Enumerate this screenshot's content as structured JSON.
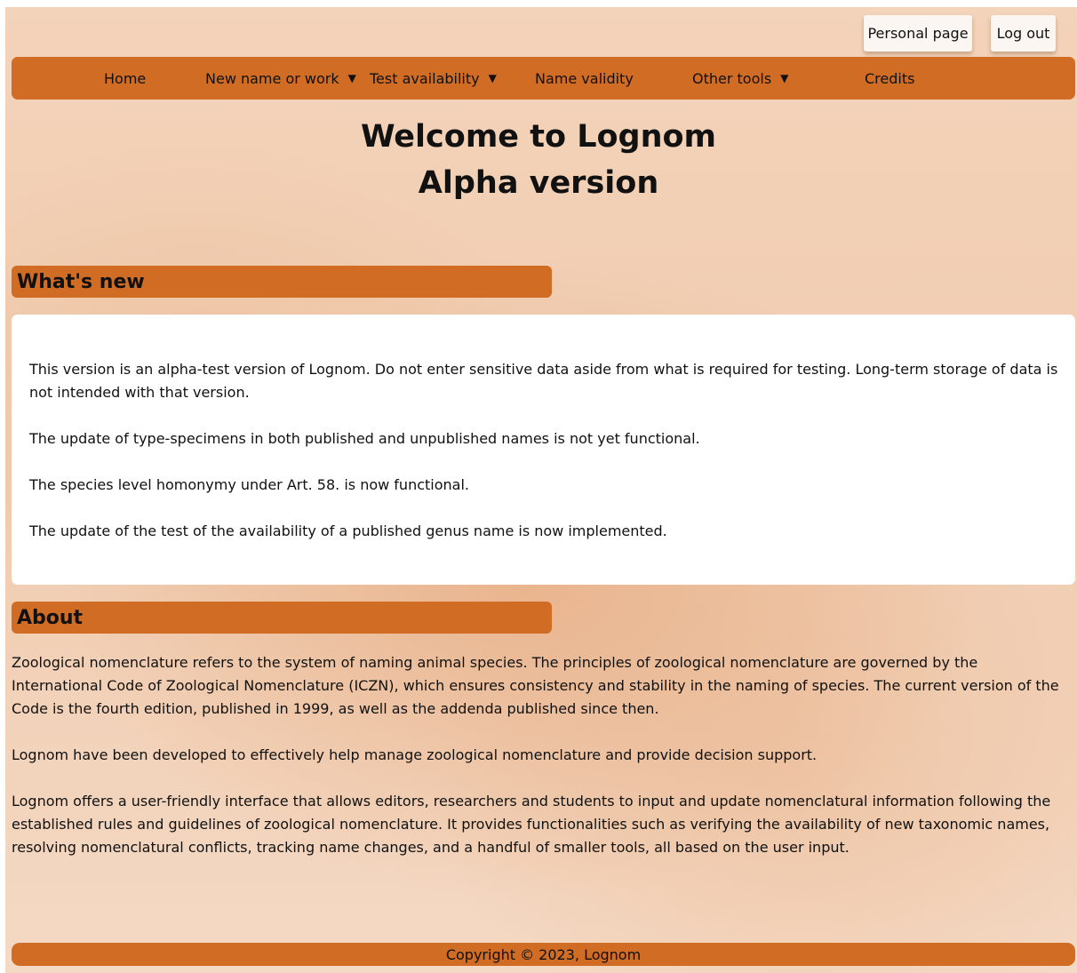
{
  "top_buttons": {
    "personal_page": "Personal page",
    "log_out": "Log out"
  },
  "nav": {
    "home": "Home",
    "new_name_or_work": "New name or work",
    "test_availability": "Test availability",
    "name_validity": "Name validity",
    "other_tools": "Other tools",
    "credits": "Credits",
    "dropdown_caret": "▼"
  },
  "title": {
    "line1": "Welcome to Lognom",
    "line2": "Alpha version"
  },
  "whats_new": {
    "heading": "What's new",
    "paragraphs": [
      "This version is an alpha-test version of Lognom. Do not enter sensitive data aside from what is required for testing. Long-term storage of data is not intended with that version.",
      "The update of type-specimens in both published and unpublished names is not yet functional.",
      "The species level homonymy under Art. 58. is now functional.",
      "The update of the test of the availability of a published genus name is now implemented."
    ]
  },
  "about": {
    "heading": "About",
    "paragraphs": [
      "Zoological nomenclature refers to the system of naming animal species. The principles of zoological nomenclature are governed by the International Code of Zoological Nomenclature (ICZN), which ensures consistency and stability in the naming of species. The current version of the Code is the fourth edition, published in 1999, as well as the addenda published since then.",
      "Lognom have been developed to effectively help manage zoological nomenclature and provide decision support.",
      "Lognom offers a user-friendly interface that allows editors, researchers and students to input and update nomenclatural information following the established rules and guidelines of zoological nomenclature. It provides functionalities such as verifying the availability of new taxonomic names, resolving nomenclatural conflicts, tracking name changes, and a handful of smaller tools, all based on the user input."
    ]
  },
  "footer": {
    "copyright": "Copyright © 2023, Lognom"
  },
  "colors": {
    "accent": "#d06c24",
    "background": "#f3d6bf",
    "panel": "#ffffff",
    "button": "#fbf6f1"
  }
}
